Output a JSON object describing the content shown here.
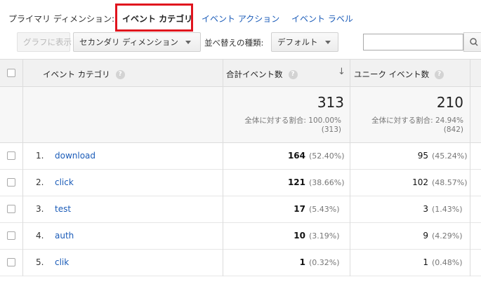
{
  "primary_dimension": {
    "label": "プライマリ ディメンション:",
    "active": "イベント カテゴリ",
    "links": [
      "イベント アクション",
      "イベント ラベル"
    ]
  },
  "toolbar": {
    "graph_button": "グラフに表示",
    "secondary_dimension": "セカンダリ ディメンション",
    "sort_label": "並べ替えの種類:",
    "sort_value": "デフォルト",
    "search_placeholder": ""
  },
  "table": {
    "headers": {
      "category": "イベント カテゴリ",
      "total_events": "合計イベント数",
      "unique_events": "ユニーク イベント数",
      "help_icon": "?",
      "sort_icon": "↓"
    },
    "totals": {
      "total_events": "313",
      "total_pct": "全体に対する割合: 100.00%",
      "total_sub": "(313)",
      "unique_events": "210",
      "unique_pct": "全体に対する割合: 24.94%",
      "unique_sub": "(842)"
    },
    "rows": [
      {
        "rank": "1.",
        "name": "download",
        "total": "164",
        "total_pct": "(52.40%)",
        "unique": "95",
        "unique_pct": "(45.24%)"
      },
      {
        "rank": "2.",
        "name": "click",
        "total": "121",
        "total_pct": "(38.66%)",
        "unique": "102",
        "unique_pct": "(48.57%)"
      },
      {
        "rank": "3.",
        "name": "test",
        "total": "17",
        "total_pct": "(5.43%)",
        "unique": "3",
        "unique_pct": "(1.43%)"
      },
      {
        "rank": "4.",
        "name": "auth",
        "total": "10",
        "total_pct": "(3.19%)",
        "unique": "9",
        "unique_pct": "(4.29%)"
      },
      {
        "rank": "5.",
        "name": "clik",
        "total": "1",
        "total_pct": "(0.32%)",
        "unique": "1",
        "unique_pct": "(0.48%)"
      }
    ]
  },
  "colors": {
    "highlight_border": "#e0141e",
    "link": "#1a5bb8"
  }
}
